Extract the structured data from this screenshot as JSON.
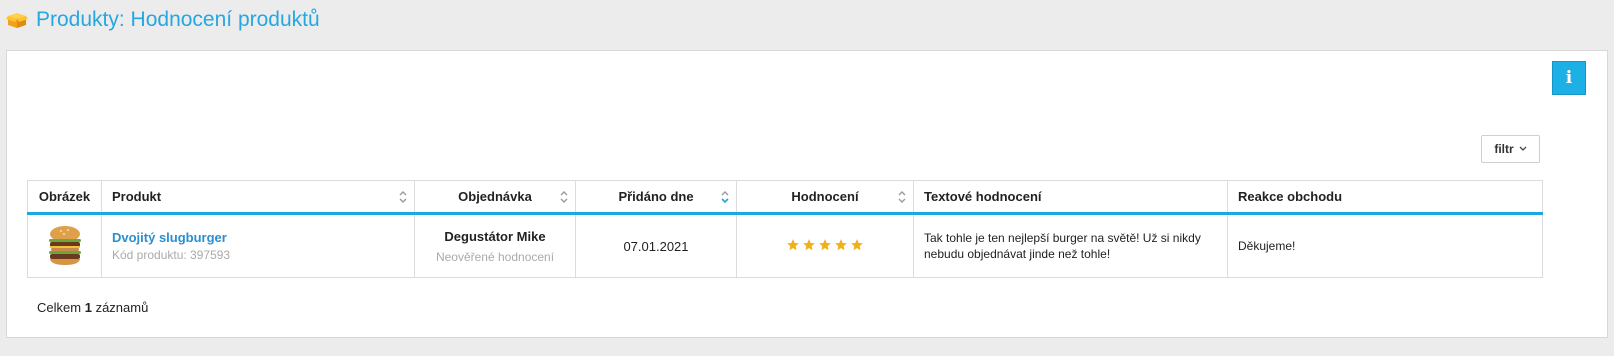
{
  "header": {
    "title": "Produkty: Hodnocení produktů",
    "icon": "package-box-icon"
  },
  "toolbar": {
    "info_icon": "info-icon",
    "info_label": "i",
    "filter_label": "filtr",
    "filter_icon": "chevron-down-icon"
  },
  "table": {
    "columns": [
      {
        "label": "Obrázek",
        "sortable": false
      },
      {
        "label": "Produkt",
        "sortable": true
      },
      {
        "label": "Objednávka",
        "sortable": true
      },
      {
        "label": "Přidáno dne",
        "sortable": true,
        "sorted": "desc"
      },
      {
        "label": "Hodnocení",
        "sortable": true
      },
      {
        "label": "Textové hodnocení",
        "sortable": false
      },
      {
        "label": "Reakce obchodu",
        "sortable": false
      }
    ],
    "rows": [
      {
        "image_icon": "burger-image",
        "product_name": "Dvojitý slugburger",
        "product_code": "Kód produktu: 397593",
        "order_author": "Degustátor Mike",
        "order_status": "Neověřené hodnocení",
        "date": "07.01.2021",
        "rating": 5,
        "review": "Tak tohle je ten nejlepší burger na světě! Už si nikdy nebudu objednávat jinde než tohle!",
        "reaction": "Děkujeme!"
      }
    ]
  },
  "footer": {
    "prefix": "Celkem",
    "count": "1",
    "suffix": "záznamů"
  },
  "colors": {
    "accent": "#1ba7e0",
    "title": "#27a7e1",
    "link": "#2a8fd0",
    "star": "#f2b01e"
  }
}
